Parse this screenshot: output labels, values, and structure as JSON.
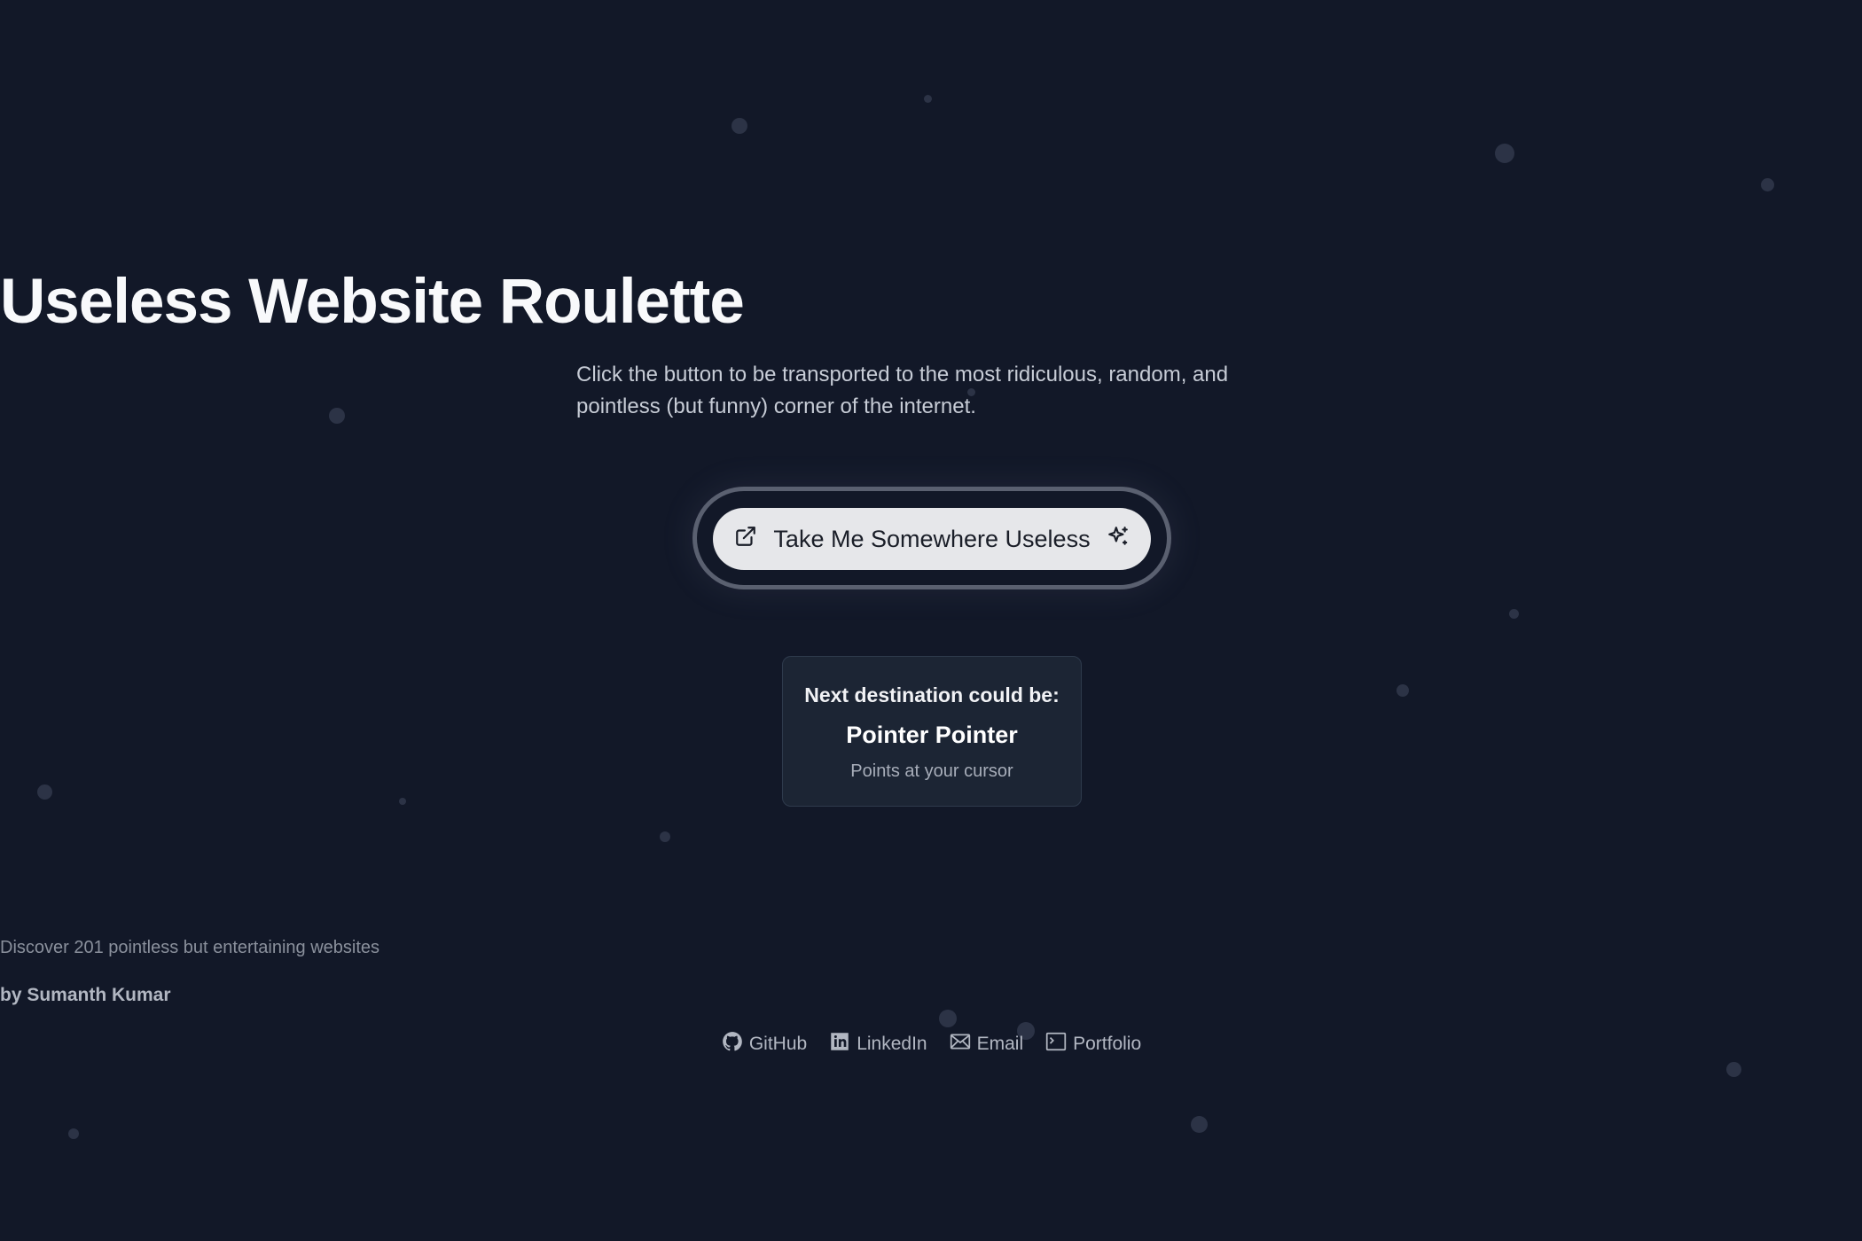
{
  "hero": {
    "title": "Useless Website Roulette",
    "subtitle": "Click the button to be transported to the most ridiculous, random, and pointless (but funny) corner of the internet."
  },
  "cta": {
    "label": "Take Me Somewhere Useless",
    "left_icon": "external-link-icon",
    "right_icon": "sparkles-icon"
  },
  "preview": {
    "heading": "Next destination could be:",
    "site_name": "Pointer Pointer",
    "site_description": "Points at your cursor"
  },
  "footer": {
    "summary": "Discover 201 pointless but entertaining websites",
    "byline": "by Sumanth Kumar",
    "links": [
      {
        "label": "GitHub",
        "icon": "github-icon"
      },
      {
        "label": "LinkedIn",
        "icon": "linkedin-icon"
      },
      {
        "label": "Email",
        "icon": "mail-icon"
      },
      {
        "label": "Portfolio",
        "icon": "terminal-icon"
      }
    ]
  },
  "colors": {
    "background": "#121828",
    "button_bg": "#e6e7ea",
    "card_bg": "#1c2534",
    "particle": "#2c3346"
  }
}
